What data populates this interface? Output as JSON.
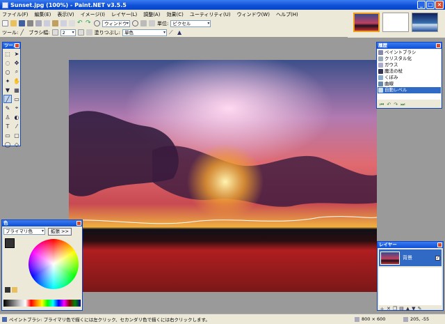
{
  "window": {
    "title": "Sunset.jpg (100%) - Paint.NET v3.5.5"
  },
  "menu": [
    "ファイル(F)",
    "編集(E)",
    "表示(V)",
    "イメージ(I)",
    "レイヤー(L)",
    "調整(A)",
    "効果(C)",
    "ユーティリティ(U)",
    "ウィンドウ(W)",
    "ヘルプ(H)"
  ],
  "toolbar1": {
    "window_select": "ウィンドウ",
    "unit_label": "単位:",
    "unit_value": "ピクセル"
  },
  "toolbar2": {
    "tool_label": "ツール:",
    "brush_width_label": "ブラシ幅:",
    "brush_width_value": "2",
    "fill_label": "塗りつぶし:",
    "fill_value": "単色"
  },
  "panels": {
    "tools": {
      "title": "ツール"
    },
    "history": {
      "title": "履歴",
      "items": [
        "ペイントブラシ",
        "クリスタル化",
        "ガウス",
        "魔法の杖",
        "くぼみ",
        "曲線",
        "自動レベル"
      ],
      "selected": "自動レベル"
    },
    "colors": {
      "title": "色",
      "mode": "プライマリ色",
      "expand_button": "拡張 >>"
    },
    "layers": {
      "title": "レイヤー",
      "layer_name": "背景"
    }
  },
  "status": {
    "hint": "ペイントブラシ: プライマリ色で描くには左クリック、セカンダリ色で描くには右クリックします。",
    "image_size": "800 × 600",
    "cursor_pos": "205, -55"
  },
  "colors_theme": {
    "titlebar": "#0c4fd6",
    "panel_bg": "#ece9d8",
    "selection": "#316ac5"
  }
}
